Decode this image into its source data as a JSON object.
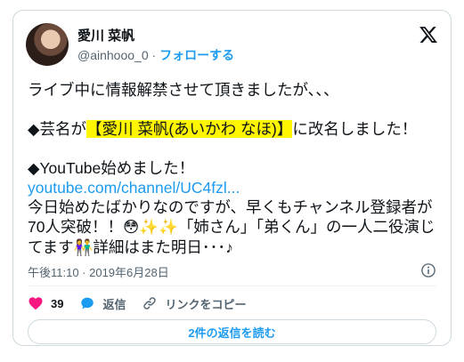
{
  "author": {
    "display_name": "愛川 菜帆",
    "handle": "@ainhooo_0",
    "separator": "·",
    "follow_label": "フォローする"
  },
  "tweet": {
    "line1": "ライブ中に情報解禁させて頂きましたが､､､",
    "rename_prefix": "◆芸名が",
    "rename_highlight": "【愛川 菜帆(あいかわ なほ)】",
    "rename_suffix": "に改名しました！",
    "youtube_line": "◆YouTube始めました！",
    "link_text": "youtube.com/channel/UC4fzl...",
    "para_a": "今日始めたばかりなのですが、早くもチャンネル登録者が70人突破！！",
    "emoji_1": "😳",
    "emoji_2": "✨",
    "emoji_3": "✨",
    "para_b": "「姉さん」「弟くん」の一人二役演じてます",
    "emoji_4": "👫",
    "para_c": "詳細はまた明日･･･♪"
  },
  "meta": {
    "timestamp": "午後11:10 · 2019年6月28日"
  },
  "actions": {
    "like_count": "39",
    "reply_label": "返信",
    "copy_link_label": "リンクをコピー"
  },
  "footer": {
    "replies_button": "2件の返信を読む"
  },
  "colors": {
    "accent": "#1d9bf0",
    "like": "#f91880",
    "highlight": "#fff600",
    "muted": "#536471"
  }
}
